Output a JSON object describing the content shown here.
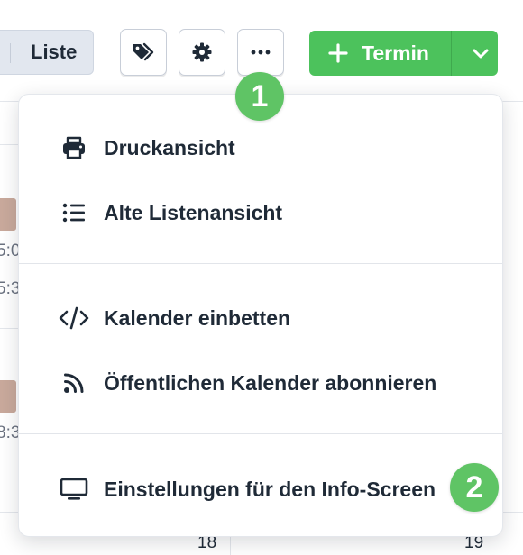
{
  "toolbar": {
    "view_toggle_label": "Liste",
    "tags_icon": "tags-icon",
    "settings_icon": "gear-icon",
    "more_icon": "ellipsis-icon",
    "new_event_label": "Termin",
    "primary_color": "#4cc25c"
  },
  "badges": {
    "first": "1",
    "second": "2",
    "color": "#5fc465"
  },
  "menu": {
    "items": [
      {
        "label": "Druckansicht",
        "icon": "printer-icon"
      },
      {
        "label": "Alte Listenansicht",
        "icon": "list-icon"
      },
      {
        "label": "Kalender einbetten",
        "icon": "code-icon"
      },
      {
        "label": "Öffentlichen Kalender abonnieren",
        "icon": "rss-feed-icon"
      },
      {
        "label": "Einstellungen für den Info-Screen",
        "icon": "monitor-icon"
      }
    ]
  },
  "background": {
    "times": [
      "5:0",
      "5:3",
      "8:3"
    ],
    "day_numbers": [
      "18",
      "19"
    ]
  }
}
